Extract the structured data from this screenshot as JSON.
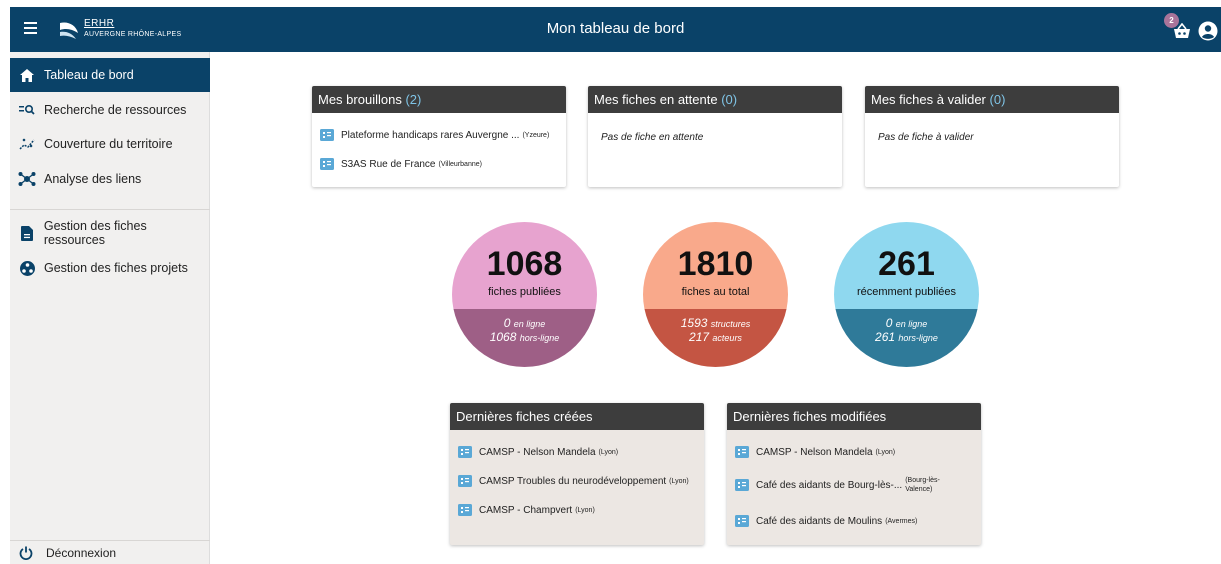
{
  "header": {
    "title": "Mon tableau de bord",
    "logo_line1": "ERHR",
    "logo_line2": "AUVERGNE RHÔNE-ALPES",
    "basket_badge": "2",
    "bar_color": "#0a4268"
  },
  "sidebar": {
    "items": [
      {
        "label": "Tableau de bord",
        "icon": "home-icon"
      },
      {
        "label": "Recherche de ressources",
        "icon": "search-list-icon"
      },
      {
        "label": "Couverture du territoire",
        "icon": "coverage-icon"
      },
      {
        "label": "Analyse des liens",
        "icon": "network-icon"
      },
      {
        "label": "Gestion des fiches ressources",
        "icon": "document-icon"
      },
      {
        "label": "Gestion des fiches projets",
        "icon": "projects-icon"
      }
    ],
    "logout": "Déconnexion"
  },
  "cards": {
    "drafts": {
      "title": "Mes brouillons",
      "count": "(2)",
      "items": [
        {
          "name": "Plateforme handicaps rares Auvergne ...",
          "location": "(Yzeure)"
        },
        {
          "name": "S3AS Rue de France",
          "location": "(Villeurbanne)"
        }
      ]
    },
    "pending": {
      "title": "Mes fiches en attente",
      "count": "(0)",
      "empty": "Pas de fiche en attente"
    },
    "to_validate": {
      "title": "Mes fiches à valider",
      "count": "(0)",
      "empty": "Pas de fiche à valider"
    }
  },
  "stats": [
    {
      "big": "1068",
      "label": "fiches publiées",
      "v1": "0",
      "t1": "en ligne",
      "v2": "1068",
      "t2": "hors-ligne",
      "top_color": "#e7a3cf",
      "bottom_color": "#9e5f86"
    },
    {
      "big": "1810",
      "label": "fiches au total",
      "v1": "1593",
      "t1": "structures",
      "v2": "217",
      "t2": "acteurs",
      "top_color": "#f9a98b",
      "bottom_color": "#c45543"
    },
    {
      "big": "261",
      "label": "récemment publiées",
      "v1": "0",
      "t1": "en ligne",
      "v2": "261",
      "t2": "hors-ligne",
      "top_color": "#8fd8ef",
      "bottom_color": "#2f7a99"
    }
  ],
  "recent": {
    "created": {
      "title": "Dernières fiches créées",
      "items": [
        {
          "name": "CAMSP - Nelson Mandela",
          "location": "(Lyon)"
        },
        {
          "name": "CAMSP Troubles du neurodéveloppement",
          "location": "(Lyon)"
        },
        {
          "name": "CAMSP - Champvert",
          "location": "(Lyon)"
        }
      ]
    },
    "modified": {
      "title": "Dernières fiches modifiées",
      "items": [
        {
          "name": "CAMSP - Nelson Mandela",
          "location": "(Lyon)"
        },
        {
          "name": "Café des aidants de Bourg-lès-...",
          "location": "(Bourg-lès-Valence)"
        },
        {
          "name": "Café des aidants de Moulins",
          "location": "(Avermes)"
        }
      ]
    }
  }
}
